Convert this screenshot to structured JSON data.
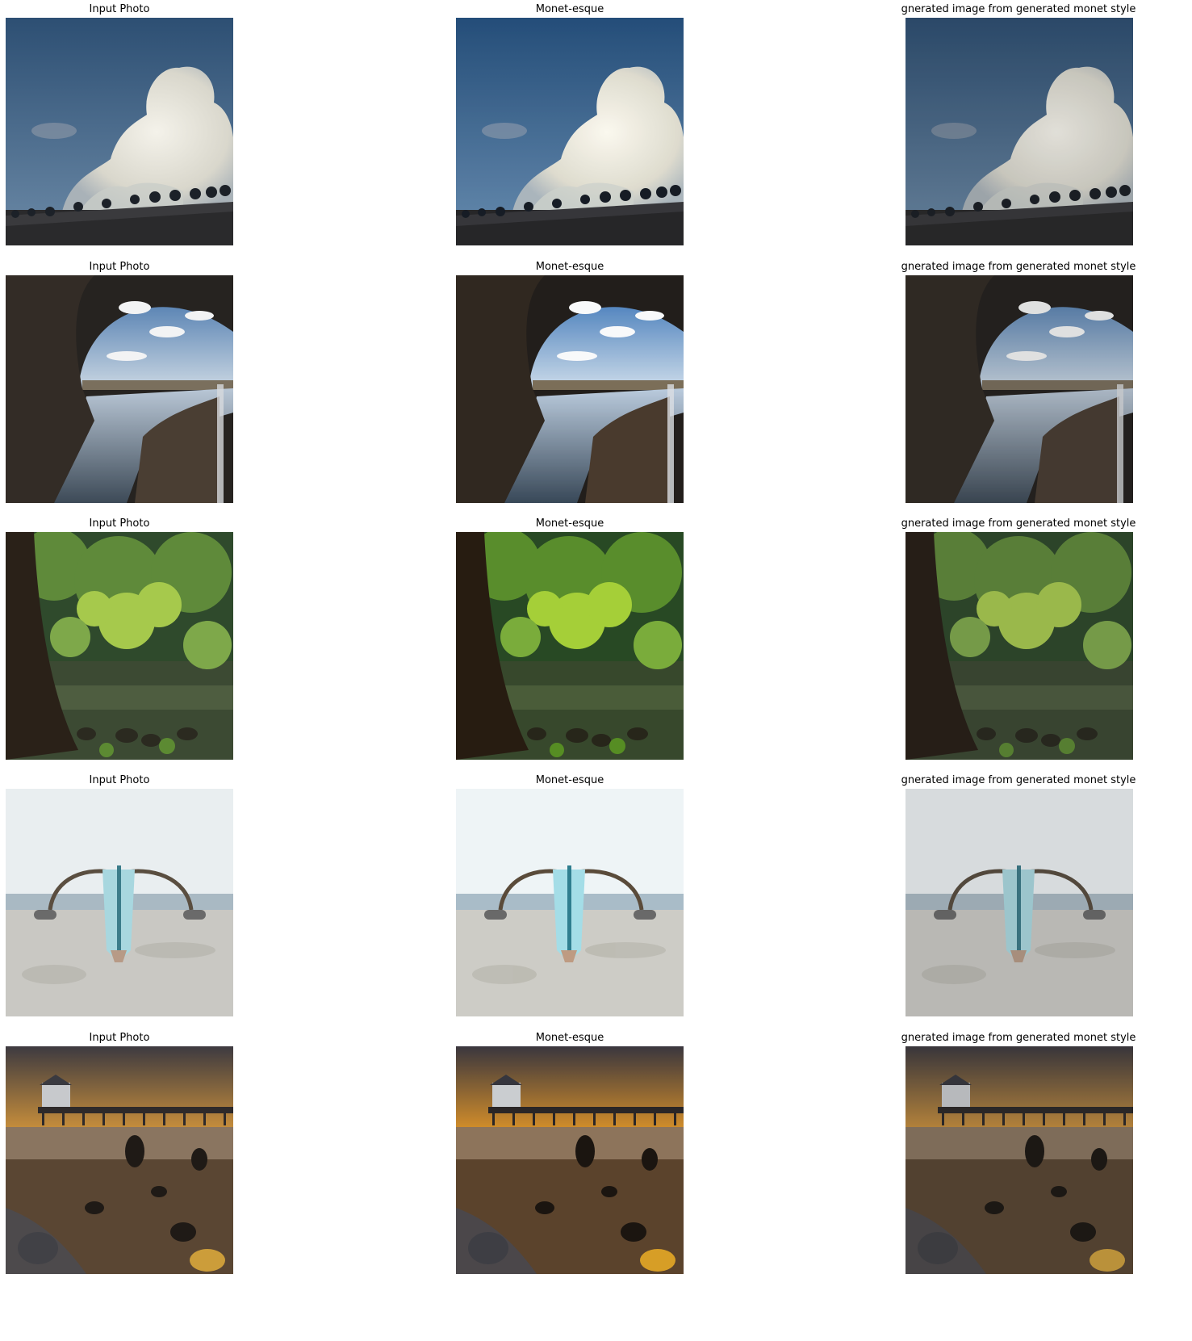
{
  "titles": {
    "col1": "Input Photo",
    "col2": "Monet-esque",
    "col3": "gnerated image from generated monet style"
  },
  "rows": [
    {
      "scene": "cumulus cloud over tree line and dark field"
    },
    {
      "scene": "stone bridge arch over river"
    },
    {
      "scene": "forest with large tree trunk and stumps"
    },
    {
      "scene": "outrigger boat on sandy beach"
    },
    {
      "scene": "pier at sunset with rocky shore"
    }
  ],
  "icons": {
    "photo": "photo-image",
    "monet": "monet-painting-image",
    "reconstructed": "reconstructed-image"
  }
}
